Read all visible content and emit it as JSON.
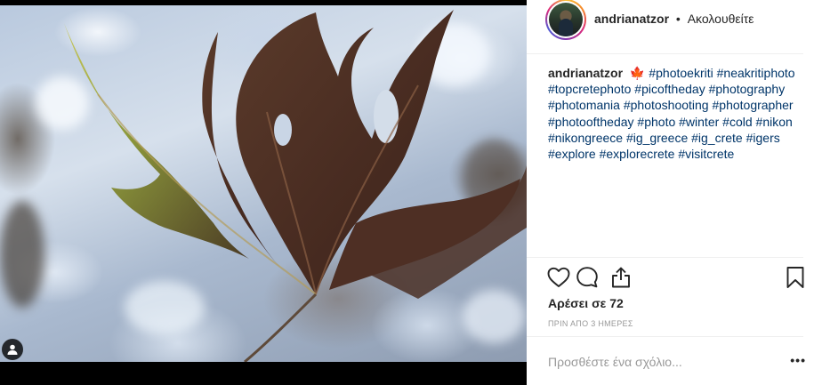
{
  "post": {
    "author": "andrianatzor",
    "separator": "•",
    "follow_status": "Ακολουθείτε",
    "caption_emoji": "🍁",
    "hashtags": [
      "#photoekriti",
      "#neakritiphoto",
      "#topcretephoto",
      "#picoftheday",
      "#photography",
      "#photomania",
      "#photoshooting",
      "#photographer",
      "#photooftheday",
      "#photo",
      "#winter",
      "#cold",
      "#nikon",
      "#nikongreece",
      "#ig_greece",
      "#ig_crete",
      "#igers",
      "#explore",
      "#explorecrete",
      "#visitcrete"
    ],
    "likes_label": "Αρέσει σε 72",
    "timestamp": "ΠΡΙΝ ΑΠΟ 3 ΗΜΕΡΕΣ"
  },
  "comment": {
    "placeholder": "Προσθέστε ένα σχόλιο...",
    "more_label": "•••"
  },
  "icons": {
    "like": "heart-icon",
    "comment": "comment-icon",
    "share": "share-icon",
    "save": "bookmark-icon",
    "user_tag": "user-tag-icon"
  },
  "colors": {
    "hashtag": "#003569",
    "text": "#262626",
    "muted": "#999999",
    "divider": "#efefef"
  }
}
